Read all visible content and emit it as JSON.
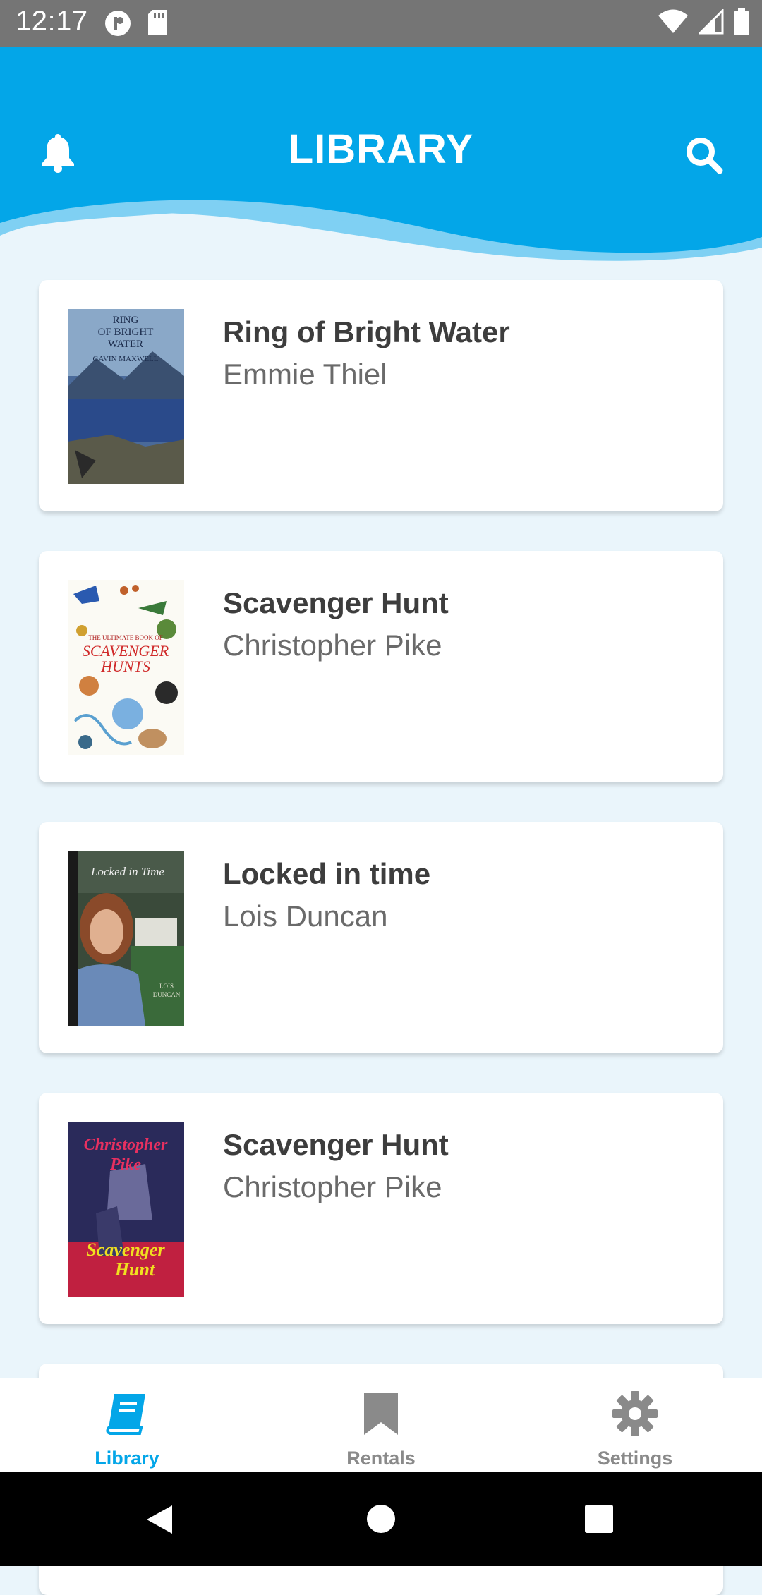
{
  "status_bar": {
    "time": "12:17",
    "left_icons": [
      "circle-badge-icon",
      "sd-card-icon"
    ],
    "right_icons": [
      "wifi-icon",
      "cell-signal-icon",
      "battery-icon"
    ]
  },
  "header": {
    "title": "LIBRARY",
    "left_icon": "bell-icon",
    "right_icon": "search-icon",
    "color": "#03a6e8"
  },
  "books": [
    {
      "title": "Ring of Bright Water",
      "author": "Emmie Thiel",
      "cover_text": [
        "RING",
        "OF BRIGHT",
        "WATER",
        "GAVIN MAXWELL"
      ]
    },
    {
      "title": "Scavenger Hunt",
      "author": "Christopher Pike",
      "cover_text": [
        "THE ULTIMATE BOOK OF",
        "SCAVENGER",
        "HUNTS"
      ]
    },
    {
      "title": "Locked in time",
      "author": "Lois Duncan",
      "cover_text": [
        "Locked in Time",
        "LOIS",
        "DUNCAN"
      ]
    },
    {
      "title": "Scavenger Hunt",
      "author": "Christopher Pike",
      "cover_text": [
        "Christopher",
        "Pike",
        "Scavenger",
        "Hunt"
      ]
    }
  ],
  "bottom_nav": [
    {
      "label": "Library",
      "icon": "book-icon",
      "active": true
    },
    {
      "label": "Rentals",
      "icon": "bookmark-icon",
      "active": false
    },
    {
      "label": "Settings",
      "icon": "gear-icon",
      "active": false
    }
  ],
  "colors": {
    "accent": "#03a6e8",
    "inactive": "#8a8a8a",
    "background": "#eaf5fb"
  }
}
